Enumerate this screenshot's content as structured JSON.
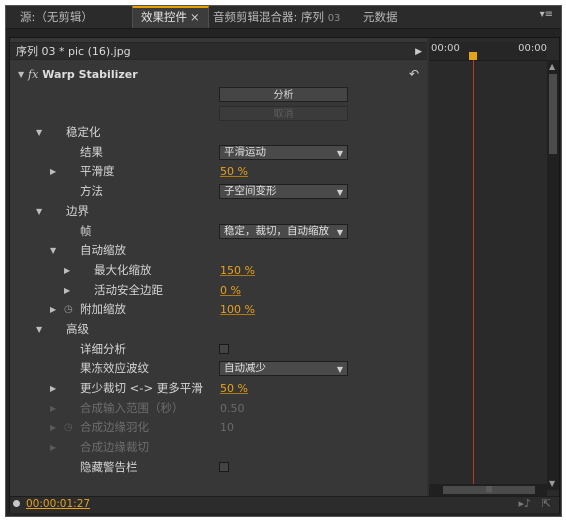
{
  "tabs": [
    {
      "label": "源:（无剪辑）",
      "active": false
    },
    {
      "label": "效果控件",
      "close": "×",
      "active": true
    },
    {
      "label": "音频剪辑混合器: 序列",
      "sub": "03",
      "active": false
    },
    {
      "label": "元数据",
      "active": false
    }
  ],
  "menu_icon": "≡",
  "sequence_label": "序列 03 * pic (16).jpg",
  "effect": {
    "fx": "fx",
    "title": "Warp Stabilizer",
    "reset_icon": "reset-icon"
  },
  "buttons": {
    "analyze": "分析",
    "cancel": "取消"
  },
  "params": [
    {
      "label": "稳定化"
    },
    {
      "label": "结果",
      "dropdown": "平滑运动"
    },
    {
      "label": "平滑度",
      "value": "50 %"
    },
    {
      "label": "方法",
      "dropdown": "子空间变形"
    },
    {
      "label": "边界"
    },
    {
      "label": "帧",
      "dropdown": "稳定，裁切，自动缩放"
    },
    {
      "label": "自动缩放"
    },
    {
      "label": "最大化缩放",
      "value": "150 %"
    },
    {
      "label": "活动安全边距",
      "value": "0 %"
    },
    {
      "label": "附加缩放",
      "value": "100 %"
    },
    {
      "label": "高级"
    },
    {
      "label": "详细分析",
      "checkbox": false
    },
    {
      "label": "果冻效应波纹",
      "dropdown": "自动减少"
    },
    {
      "label": "更少裁切 <-> 更多平滑",
      "value": "50 %"
    },
    {
      "label": "合成输入范围（秒）",
      "value": "0.50"
    },
    {
      "label": "合成边缘羽化",
      "value": "10"
    },
    {
      "label": "合成边缘裁切"
    },
    {
      "label": "隐藏警告栏",
      "checkbox": false
    }
  ],
  "timeline": {
    "start": "00:00",
    "end": "00:00",
    "scroll_grip": "|||"
  },
  "footer": {
    "timecode": "00:00:01:27"
  },
  "colors": {
    "accent": "#e5a21e",
    "playhead_line": "#b33b2a",
    "panel_bg": "#373737"
  }
}
